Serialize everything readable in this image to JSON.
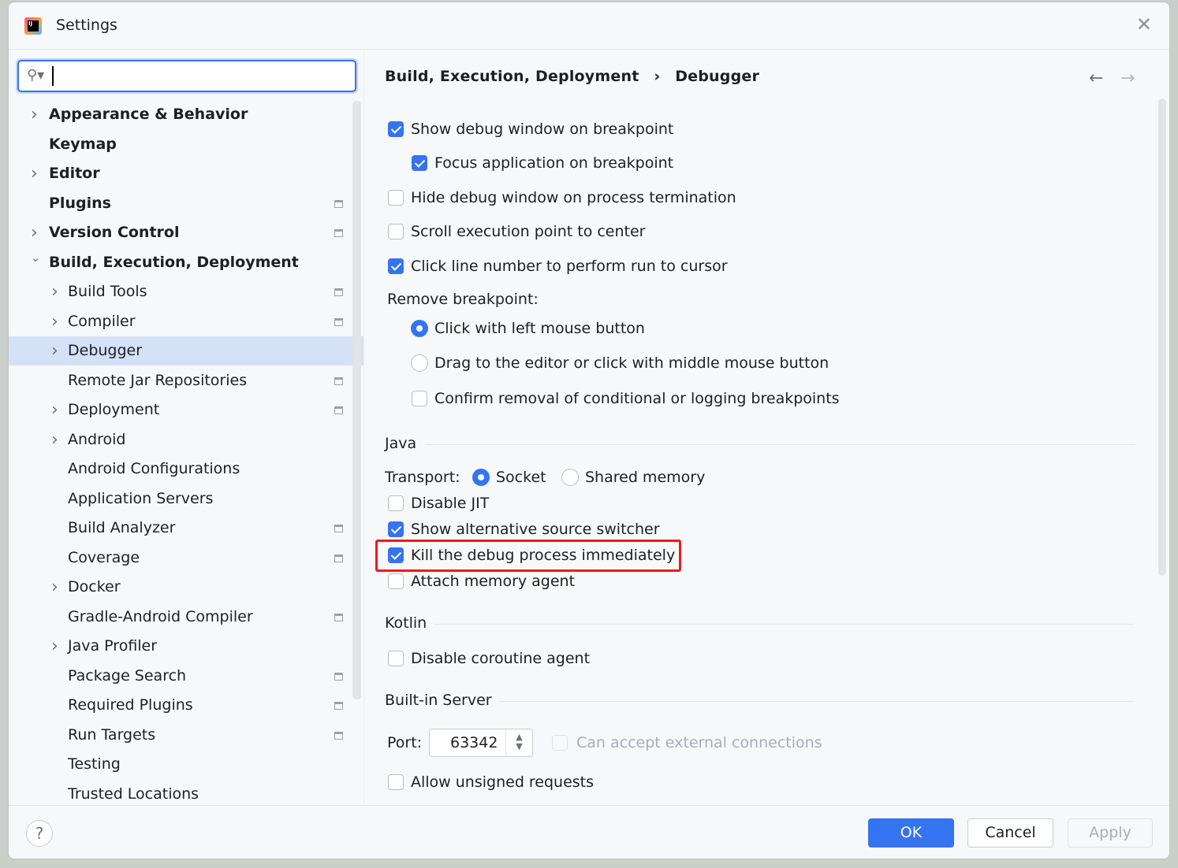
{
  "window": {
    "title": "Settings",
    "close_icon": "close-icon",
    "logo": "IJ"
  },
  "search": {
    "value": "",
    "placeholder": ""
  },
  "sidebar": {
    "items": [
      {
        "label": "Appearance & Behavior",
        "level": 0,
        "expandable": true,
        "bold": true,
        "pinned": false
      },
      {
        "label": "Keymap",
        "level": 0,
        "expandable": false,
        "pinned": false
      },
      {
        "label": "Editor",
        "level": 0,
        "expandable": true,
        "pinned": false
      },
      {
        "label": "Plugins",
        "level": 0,
        "expandable": false,
        "pinned": true
      },
      {
        "label": "Version Control",
        "level": 0,
        "expandable": true,
        "pinned": true
      },
      {
        "label": "Build, Execution, Deployment",
        "level": 0,
        "expandable": true,
        "expanded": true,
        "pinned": false
      },
      {
        "label": "Build Tools",
        "level": 1,
        "expandable": true,
        "pinned": true
      },
      {
        "label": "Compiler",
        "level": 1,
        "expandable": true,
        "pinned": true
      },
      {
        "label": "Debugger",
        "level": 1,
        "expandable": true,
        "pinned": false,
        "selected": true
      },
      {
        "label": "Remote Jar Repositories",
        "level": 1,
        "expandable": false,
        "pinned": true
      },
      {
        "label": "Deployment",
        "level": 1,
        "expandable": true,
        "pinned": true
      },
      {
        "label": "Android",
        "level": 1,
        "expandable": true,
        "pinned": false
      },
      {
        "label": "Android Configurations",
        "level": 1,
        "expandable": false,
        "pinned": false
      },
      {
        "label": "Application Servers",
        "level": 1,
        "expandable": false,
        "pinned": false
      },
      {
        "label": "Build Analyzer",
        "level": 1,
        "expandable": false,
        "pinned": true
      },
      {
        "label": "Coverage",
        "level": 1,
        "expandable": false,
        "pinned": true
      },
      {
        "label": "Docker",
        "level": 1,
        "expandable": true,
        "pinned": false
      },
      {
        "label": "Gradle-Android Compiler",
        "level": 1,
        "expandable": false,
        "pinned": true
      },
      {
        "label": "Java Profiler",
        "level": 1,
        "expandable": true,
        "pinned": false
      },
      {
        "label": "Package Search",
        "level": 1,
        "expandable": false,
        "pinned": true
      },
      {
        "label": "Required Plugins",
        "level": 1,
        "expandable": false,
        "pinned": true
      },
      {
        "label": "Run Targets",
        "level": 1,
        "expandable": false,
        "pinned": true
      },
      {
        "label": "Testing",
        "level": 1,
        "expandable": false,
        "pinned": false
      },
      {
        "label": "Trusted Locations",
        "level": 1,
        "expandable": false,
        "pinned": false
      }
    ]
  },
  "breadcrumb": {
    "parent": "Build, Execution, Deployment",
    "separator": "›",
    "current": "Debugger",
    "back_icon": "arrow-left-icon",
    "forward_icon": "arrow-right-icon"
  },
  "options": {
    "show_debug_window": {
      "label": "Show debug window on breakpoint",
      "checked": true
    },
    "focus_app": {
      "label": "Focus application on breakpoint",
      "checked": true
    },
    "hide_debug_window": {
      "label": "Hide debug window on process termination",
      "checked": false
    },
    "scroll_exec": {
      "label": "Scroll execution point to center",
      "checked": false
    },
    "click_line": {
      "label": "Click line number to perform run to cursor",
      "checked": true
    },
    "remove_bp_label": "Remove breakpoint:",
    "remove_left": {
      "label": "Click with left mouse button",
      "selected": true
    },
    "remove_drag": {
      "label": "Drag to the editor or click with middle mouse button",
      "selected": false
    },
    "confirm_removal": {
      "label": "Confirm removal of conditional or logging breakpoints",
      "checked": false
    }
  },
  "java": {
    "title": "Java",
    "transport_label": "Transport:",
    "socket": {
      "label": "Socket",
      "selected": true
    },
    "shared": {
      "label": "Shared memory",
      "selected": false
    },
    "disable_jit": {
      "label": "Disable JIT",
      "checked": false
    },
    "alt_source": {
      "label": "Show alternative source switcher",
      "checked": true
    },
    "kill_debug": {
      "label": "Kill the debug process immediately",
      "checked": true,
      "highlighted": true,
      "highlight_color": "#f0191e"
    },
    "memory_agent": {
      "label": "Attach memory agent",
      "checked": false
    }
  },
  "kotlin": {
    "title": "Kotlin",
    "disable_coroutine": {
      "label": "Disable coroutine agent",
      "checked": false
    }
  },
  "server": {
    "title": "Built-in Server",
    "port_label": "Port:",
    "port_value": "63342",
    "external": {
      "label": "Can accept external connections",
      "checked": false,
      "disabled": true
    },
    "unsigned": {
      "label": "Allow unsigned requests",
      "checked": false
    }
  },
  "footer": {
    "help": "?",
    "ok": "OK",
    "cancel": "Cancel",
    "apply": "Apply"
  },
  "colors": {
    "accent": "#3574f0",
    "selection": "#d5e1f7"
  }
}
